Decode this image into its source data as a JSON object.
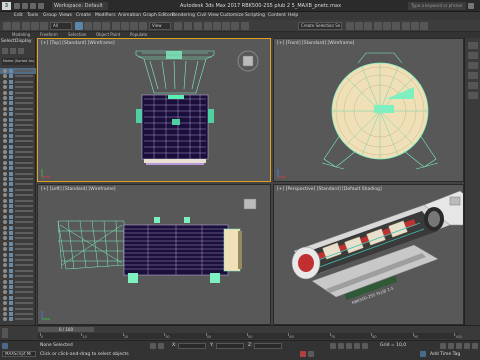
{
  "titlebar": {
    "app_letter": "3",
    "workspace": "Workspace: Default",
    "title": "Autodesk 3ds Max 2017    RBK500-2S5 plub 2 5_MAXB_pnetc.max",
    "search_placeholder": "Type a keyword or phrase"
  },
  "menu": [
    "Edit",
    "Tools",
    "Group",
    "Views",
    "Create",
    "Modifiers",
    "Animation",
    "Graph Editors",
    "Rendering",
    "Civil View",
    "Customize",
    "Scripting",
    "Content",
    "Help"
  ],
  "toolbar": {
    "filter": "All",
    "view_mode": "View",
    "selection_set": "Create Selection Se"
  },
  "ribbon": [
    "Modeling",
    "Freeform",
    "Selection",
    "Object Paint",
    "Populate"
  ],
  "left_panel": {
    "tabs": [
      "Select",
      "Display"
    ],
    "sort_header": "Name (Sorted Ascend)"
  },
  "viewports": {
    "top": "[+] [Top] [Standard] [Wireframe]",
    "front": "[+] [Front] [Standard] [Wireframe]",
    "left": "[+] [Left] [Standard] [Wireframe]",
    "perspective": "[+] [Perspective] [Standard] [Default Shading]",
    "model_label": "RBK500-2S5 PLUB 2-5"
  },
  "timeline": {
    "frame": "0 / 100",
    "ticks": [
      "0",
      "10",
      "20",
      "30",
      "40",
      "50",
      "60",
      "70",
      "80",
      "90",
      "100"
    ]
  },
  "status": {
    "selection": "None Selected",
    "prompt": "Click or click-and-drag to select objects",
    "x_label": "X:",
    "y_label": "Y:",
    "z_label": "Z:",
    "grid": "Grid = 10,0",
    "add_time_tag": "Add Time Tag",
    "maxscript": "MAXScript Mi"
  },
  "colors": {
    "accent_active": "#e0a020",
    "wire_green": "#7ef0c0",
    "wire_purple": "#1a0f3a",
    "perspective_bg": "#5a5a5a"
  }
}
